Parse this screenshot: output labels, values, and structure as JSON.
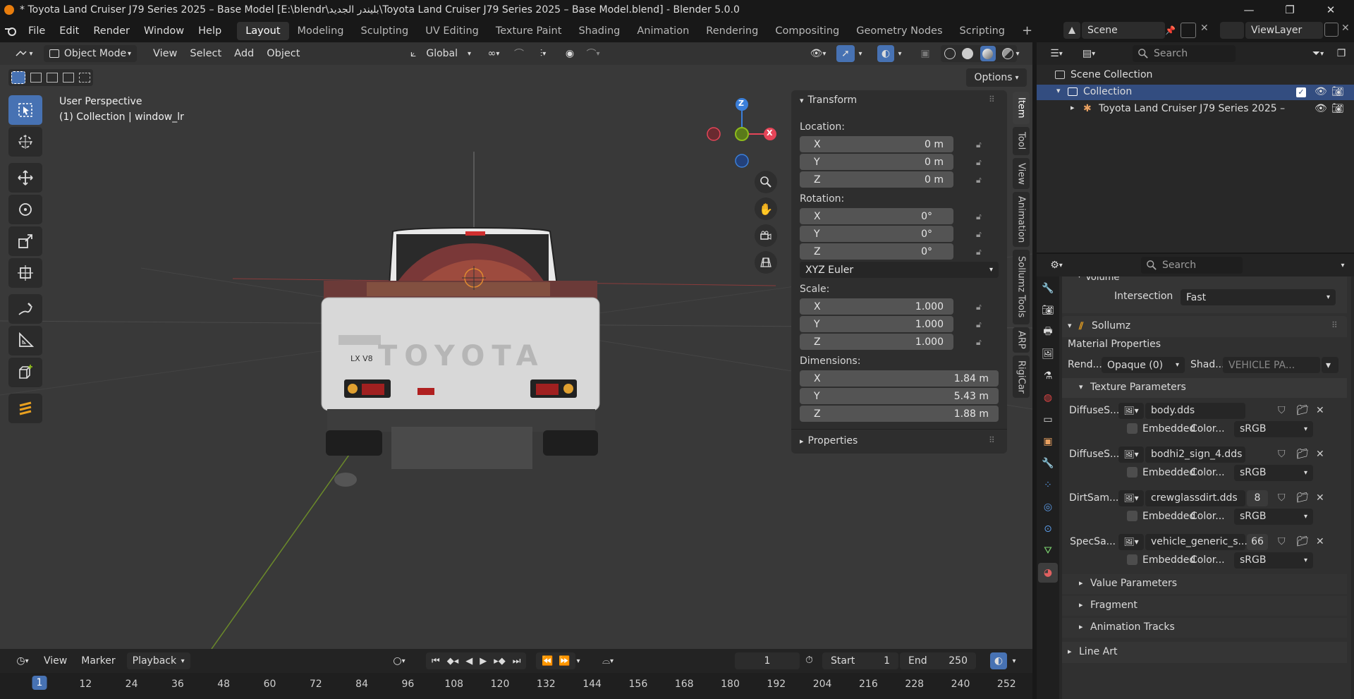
{
  "window": {
    "title": "* Toyota Land Cruiser J79 Series 2025 – Base Model [E:\\blendr\\بليندر الجديد\\Toyota Land Cruiser J79 Series 2025 – Base Model.blend] - Blender 5.0.0",
    "controls": [
      "—",
      "❐",
      "✕"
    ]
  },
  "menu": {
    "items": [
      "File",
      "Edit",
      "Render",
      "Window",
      "Help"
    ],
    "workspaces": [
      "Layout",
      "Modeling",
      "Sculpting",
      "UV Editing",
      "Texture Paint",
      "Shading",
      "Animation",
      "Rendering",
      "Compositing",
      "Geometry Nodes",
      "Scripting"
    ],
    "active_workspace": "Layout",
    "add_tab": "+",
    "scene_label": "Scene",
    "viewlayer_label": "ViewLayer"
  },
  "viewport_header": {
    "mode": "Object Mode",
    "items": [
      "View",
      "Select",
      "Add",
      "Object"
    ],
    "transform_orientation": "Global",
    "options_label": "Options"
  },
  "viewport": {
    "perspective_label": "User Perspective",
    "collection_label": "(1) Collection | window_lr",
    "car_badge": "LX V8",
    "car_brand": "TOYOTA",
    "gizmo_axes": [
      "Z",
      "X"
    ]
  },
  "npanel": {
    "transform_header": "Transform",
    "location_label": "Location:",
    "location": [
      {
        "axis": "X",
        "value": "0 m"
      },
      {
        "axis": "Y",
        "value": "0 m"
      },
      {
        "axis": "Z",
        "value": "0 m"
      }
    ],
    "rotation_label": "Rotation:",
    "rotation": [
      {
        "axis": "X",
        "value": "0°"
      },
      {
        "axis": "Y",
        "value": "0°"
      },
      {
        "axis": "Z",
        "value": "0°"
      }
    ],
    "rotation_mode": "XYZ Euler",
    "scale_label": "Scale:",
    "scale": [
      {
        "axis": "X",
        "value": "1.000"
      },
      {
        "axis": "Y",
        "value": "1.000"
      },
      {
        "axis": "Z",
        "value": "1.000"
      }
    ],
    "dimensions_label": "Dimensions:",
    "dimensions": [
      {
        "axis": "X",
        "value": "1.84 m"
      },
      {
        "axis": "Y",
        "value": "5.43 m"
      },
      {
        "axis": "Z",
        "value": "1.88 m"
      }
    ],
    "properties_header": "Properties",
    "tabs": [
      "Item",
      "Tool",
      "View",
      "Animation",
      "Sollumz Tools",
      "ARP",
      "RigiCar"
    ],
    "active_tab": "Item"
  },
  "outliner": {
    "search_placeholder": "Search",
    "scene_collection": "Scene Collection",
    "collection": "Collection",
    "object": "Toyota Land Cruiser J79 Series 2025 –"
  },
  "properties": {
    "search_placeholder": "Search",
    "volume_label": "Volume",
    "intersection_label": "Intersection",
    "intersection_value": "Fast",
    "sollumz_header": "Sollumz",
    "material_properties": "Material Properties",
    "render_label": "Rend...",
    "render_value": "Opaque (0)",
    "shader_label": "Shad...",
    "shader_value": "VEHICLE PA...",
    "texture_params_header": "Texture Parameters",
    "embedded_label": "Embedded",
    "color_label": "Color...",
    "textures": [
      {
        "slot": "DiffuseS...",
        "file": "body.dds",
        "users": "",
        "colorspace": "sRGB"
      },
      {
        "slot": "DiffuseS...",
        "file": "bodhi2_sign_4.dds",
        "users": "",
        "colorspace": "sRGB"
      },
      {
        "slot": "DirtSam...",
        "file": "crewglassdirt.dds",
        "users": "8",
        "colorspace": "sRGB"
      },
      {
        "slot": "SpecSa...",
        "file": "vehicle_generic_s...",
        "users": "66",
        "colorspace": "sRGB"
      }
    ],
    "collapsed_sections": [
      "Value Parameters",
      "Fragment",
      "Animation Tracks"
    ],
    "line_art": "Line Art"
  },
  "timeline": {
    "items": [
      "View",
      "Marker",
      "Playback"
    ],
    "current_frame": "1",
    "start_label": "Start",
    "start_value": "1",
    "end_label": "End",
    "end_value": "250",
    "ruler": [
      "1",
      "12",
      "24",
      "36",
      "48",
      "60",
      "72",
      "84",
      "96",
      "108",
      "120",
      "132",
      "144",
      "156",
      "168",
      "180",
      "192",
      "204",
      "216",
      "228",
      "240",
      "252"
    ]
  },
  "colors": {
    "accent": "#4772b3",
    "x_axis": "#e64558",
    "y_axis": "#8dbb1c",
    "z_axis": "#3b7fd9",
    "blender_orange": "#e87d0d"
  }
}
